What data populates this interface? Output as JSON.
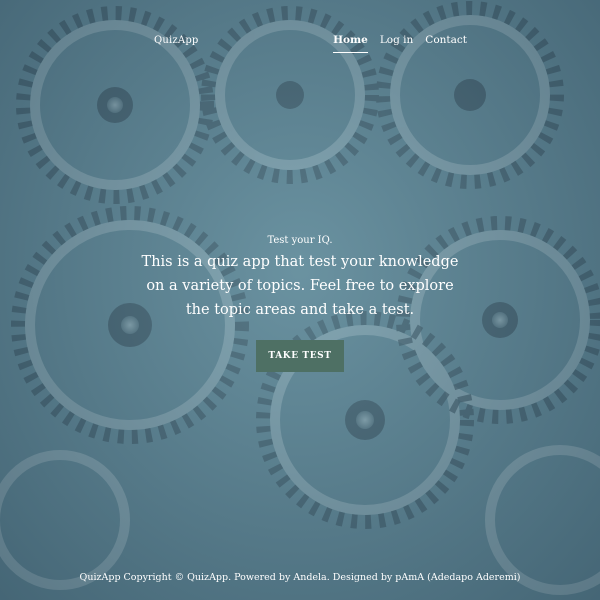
{
  "nav": {
    "brand": "QuizApp",
    "links": [
      {
        "label": "Home"
      },
      {
        "label": "Log in"
      },
      {
        "label": "Contact"
      }
    ]
  },
  "hero": {
    "eyebrow": "Test your IQ.",
    "headline": "This is a quiz app that test your knowledge on a variety of topics. Feel free to explore the topic areas and take a test.",
    "cta_label": "TAKE TEST"
  },
  "footer": {
    "text": "QuizApp Copyright © QuizApp. Powered by Andela. Designed by pAmA (Adedapo Aderemi)"
  },
  "colors": {
    "background": "#5f8797",
    "cta": "#4e7064",
    "text": "#ffffff"
  }
}
